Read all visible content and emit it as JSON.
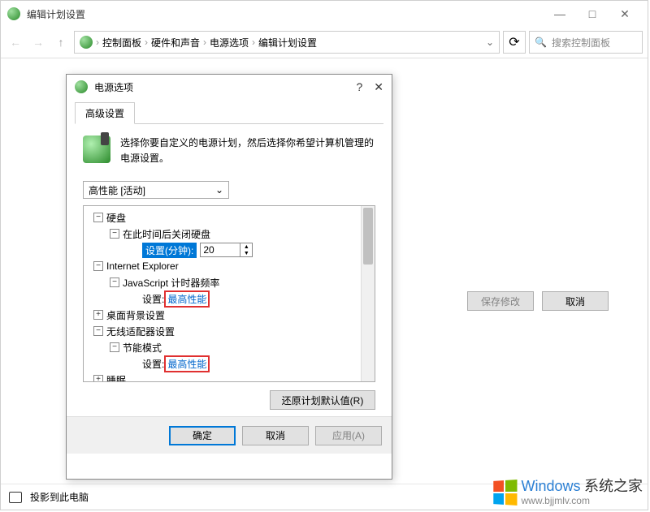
{
  "window": {
    "title": "编辑计划设置",
    "minimize": "—",
    "maximize": "□",
    "close": "✕"
  },
  "toolbar": {
    "back": "←",
    "forward": "→",
    "up": "↑",
    "refresh": "⟳",
    "dropdown": "⌄"
  },
  "breadcrumb": {
    "sep": "›",
    "items": [
      "控制面板",
      "硬件和声音",
      "电源选项",
      "编辑计划设置"
    ]
  },
  "search": {
    "icon": "🔍",
    "placeholder": "搜索控制面板"
  },
  "content_buttons": {
    "save": "保存修改",
    "cancel": "取消"
  },
  "projection": {
    "label": "投影到此电脑"
  },
  "dialog": {
    "icon_title": "电源选项",
    "help": "?",
    "close": "✕",
    "tab": "高级设置",
    "intro": "选择你要自定义的电源计划，然后选择你希望计算机管理的电源设置。",
    "plan_selected": "高性能 [活动]",
    "plan_caret": "⌄",
    "tree": {
      "hard_disk": "硬盘",
      "turn_off_after": "在此时间后关闭硬盘",
      "setting_minutes_label": "设置(分钟):",
      "setting_minutes_value": "20",
      "ie": "Internet Explorer",
      "js_timer": "JavaScript 计时器频率",
      "setting_label": "设置:",
      "max_perf": "最高性能",
      "desktop_bg": "桌面背景设置",
      "wireless": "无线适配器设置",
      "power_saving": "节能模式",
      "sleep": "睡眠",
      "exp_minus": "−",
      "exp_plus": "+"
    },
    "restore_defaults": "还原计划默认值(R)",
    "ok": "确定",
    "cancel": "取消",
    "apply": "应用(A)"
  },
  "watermark": {
    "brand": "Windows",
    "sub1": "系统之家",
    "url": "www.bjjmlv.com"
  }
}
